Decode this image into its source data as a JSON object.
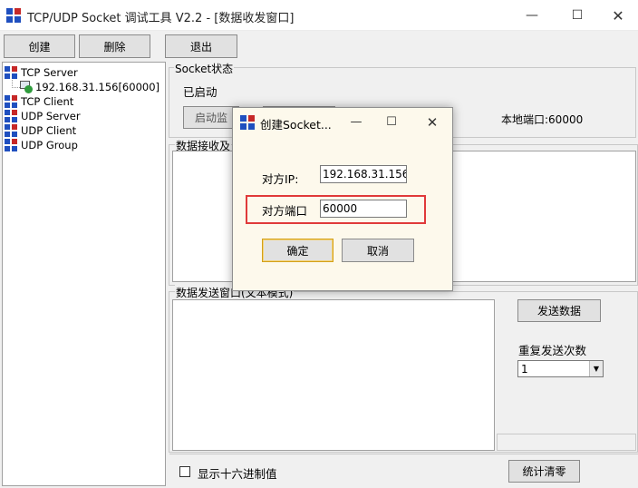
{
  "window": {
    "title": "TCP/UDP Socket 调试工具 V2.2 - [数据收发窗口]",
    "controls": {
      "minimize": "—",
      "maximize": "☐",
      "close": "✕"
    }
  },
  "toolbar": {
    "create_label": "创建",
    "delete_label": "删除",
    "exit_label": "退出"
  },
  "tree": {
    "items": [
      {
        "label": "TCP Server"
      },
      {
        "label": "TCP Client"
      },
      {
        "label": "UDP Server"
      },
      {
        "label": "UDP Client"
      },
      {
        "label": "UDP Group"
      }
    ],
    "connection": {
      "label": "192.168.31.156[60000]"
    }
  },
  "socket_status": {
    "group_label": "Socket状态",
    "status": "已启动",
    "start_label": "启动监",
    "local_port": "本地端口:60000"
  },
  "receive": {
    "group_label": "数据接收及"
  },
  "send": {
    "group_label": "数据发送窗口(文本模式)",
    "send_label": "发送数据",
    "repeat_label": "重复发送次数",
    "repeat_value": "1"
  },
  "bottom": {
    "hex_label": "显示十六进制值",
    "clear_label": "统计清零"
  },
  "dialog": {
    "title": "创建Socket...",
    "controls": {
      "minimize": "—",
      "maximize": "☐",
      "close": "✕"
    },
    "ip_label": "对方IP:",
    "ip_value": "192.168.31.156",
    "port_label": "对方端口",
    "port_value": "60000",
    "ok_label": "确定",
    "cancel_label": "取消"
  },
  "colors": {
    "highlight": "#e03a3a",
    "dialog_bg": "#fdf9ec",
    "icon_blue": "#1f4fbf",
    "icon_red": "#c62828"
  }
}
